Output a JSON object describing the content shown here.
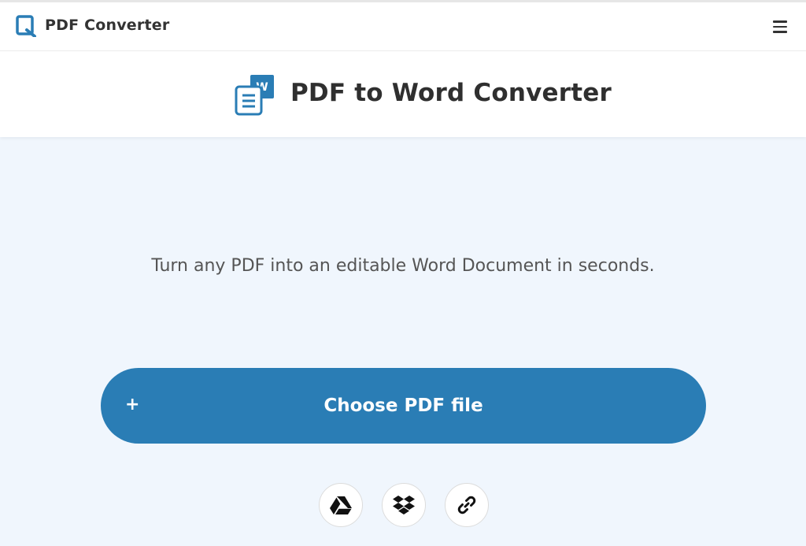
{
  "header": {
    "brand": "PDF Converter",
    "logo_icon": "pdf-converter-logo-icon",
    "menu_icon": "hamburger-menu-icon"
  },
  "hero": {
    "title": "PDF to Word Converter",
    "icon": "pdf-to-word-icon",
    "icon_badge": "W"
  },
  "main": {
    "tagline": "Turn any PDF into an editable Word Document in seconds.",
    "choose_button": {
      "plus": "+",
      "label": "Choose PDF file"
    },
    "sources": [
      {
        "name": "google-drive",
        "icon": "google-drive-icon"
      },
      {
        "name": "dropbox",
        "icon": "dropbox-icon"
      },
      {
        "name": "url-link",
        "icon": "link-icon"
      }
    ]
  },
  "colors": {
    "accent": "#2a7db5",
    "background": "#f0f6fd",
    "text": "#333333"
  }
}
